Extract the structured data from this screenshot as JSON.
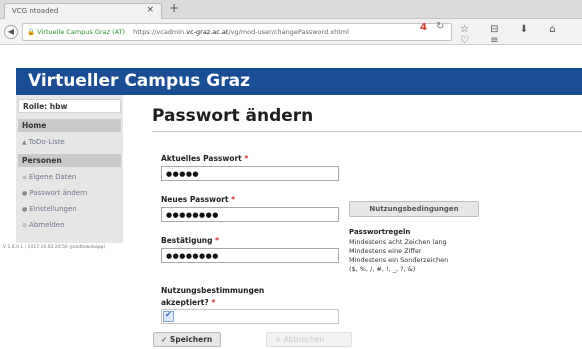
{
  "browser": {
    "tab_title": "VCG ntoaded",
    "tab_close": "×",
    "new_tab": "+",
    "url_site": "Virtuelle Campus Graz (AT)",
    "url_prefix": "https://vcadmin.",
    "url_domain": "vc-graz.ac.at",
    "url_rest": "/vg/mod-user/changePassword.xhtml",
    "badge": "4",
    "reload": "↻",
    "toolbar_icons": "☆ ⊟ ⬇ ⌂ ♡ ≡"
  },
  "banner": {
    "title": "Virtueller Campus Graz"
  },
  "sidebar": {
    "role": "Rolle: hbw",
    "home_heading": "Home",
    "todo": "ToDo-Liste",
    "personen_heading": "Personen",
    "items": [
      "Eigene Daten",
      "Passwort ändern",
      "Einstellungen",
      "Abmelden"
    ],
    "version": "V 1.6.0.1 / 2017.10.03 20:56 (prodtowebapp)"
  },
  "page": {
    "title": "Passwort ändern",
    "current_label": "Aktuelles Passwort",
    "current_value": "●●●●●",
    "new_label": "Neues Passwort",
    "new_value": "●●●●●●●●",
    "confirm_label": "Bestätigung",
    "confirm_value": "●●●●●●●●",
    "required_mark": "*",
    "terms_button": "Nutzungsbedingungen",
    "rules_title": "Passwortregeln",
    "rules": [
      "Mindestens acht Zeichen lang",
      "Mindestens eine Ziffer",
      "Mindestens ein Sonderzeichen",
      "($, %, /, #, !, _, ?, &)"
    ],
    "accept_label_line1": "Nutzungsbestimmungen",
    "accept_label_line2": "akzeptiert?",
    "accept_checked": true,
    "save_button": "Speichern",
    "cancel_button": "Abbrechen"
  },
  "colors": {
    "banner": "#1a4d93",
    "required": "#d42a2a",
    "sidebar_bg": "#e6e6e6"
  }
}
